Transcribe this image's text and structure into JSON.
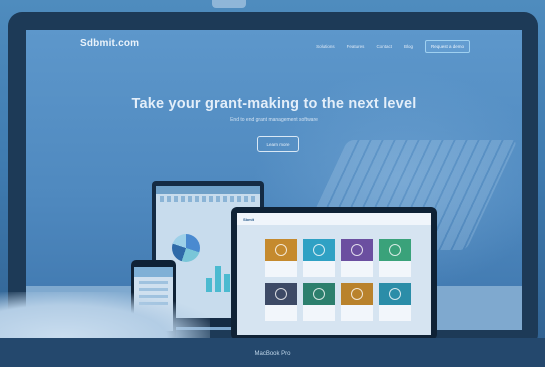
{
  "site": {
    "logo": "Sdbmit.com",
    "nav": [
      "Solutions",
      "Features",
      "Contact",
      "Blog"
    ],
    "cta": "Request a demo",
    "hero_title": "Take your grant-making to the next level",
    "hero_subtitle": "End to end grant management software",
    "hero_button": "Learn more"
  },
  "device": {
    "brand_label": "MacBook Pro"
  },
  "tablet": {
    "header": "Sbmit"
  },
  "colors": {
    "overlay": "#3b74a8",
    "accent": "#9fd0f0"
  }
}
